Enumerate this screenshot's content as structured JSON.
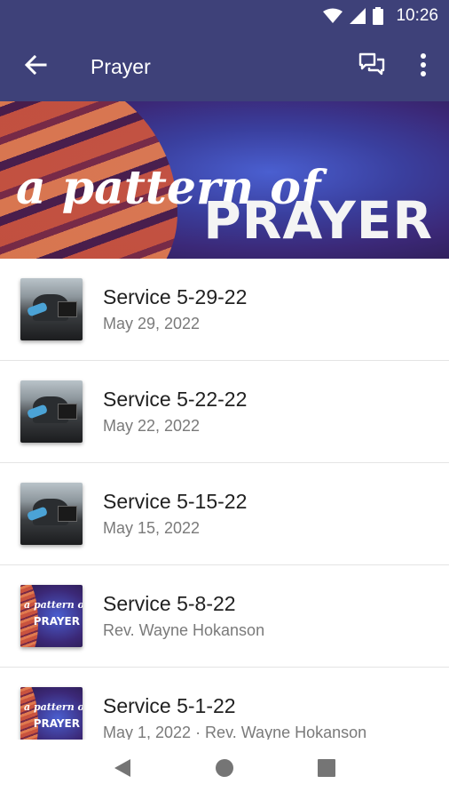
{
  "status_bar": {
    "time": "10:26"
  },
  "app_bar": {
    "title": "Prayer",
    "icons": [
      "back-arrow-icon",
      "chat-icon",
      "more-vert-icon"
    ]
  },
  "hero": {
    "line1": "a pattern of",
    "line2": "PRAYER"
  },
  "items": [
    {
      "title": "Service 5-29-22",
      "subtitle": "May 29, 2022",
      "thumb": "photo"
    },
    {
      "title": "Service 5-22-22",
      "subtitle": "May 22, 2022",
      "thumb": "photo"
    },
    {
      "title": "Service 5-15-22",
      "subtitle": "May 15, 2022",
      "thumb": "photo"
    },
    {
      "title": "Service 5-8-22",
      "subtitle": "Rev. Wayne Hokanson",
      "thumb": "series"
    },
    {
      "title": "Service 5-1-22",
      "subtitle": "May 1, 2022 · Rev. Wayne Hokanson",
      "thumb": "series"
    }
  ],
  "thumb_series": {
    "line1": "a pattern of",
    "line2": "PRAYER"
  },
  "nav_bar": {
    "icons": [
      "back-triangle-icon",
      "home-circle-icon",
      "recents-square-icon"
    ]
  },
  "colors": {
    "primary": "#3e4179",
    "text": "#212121",
    "secondary_text": "#7a7a7a"
  }
}
